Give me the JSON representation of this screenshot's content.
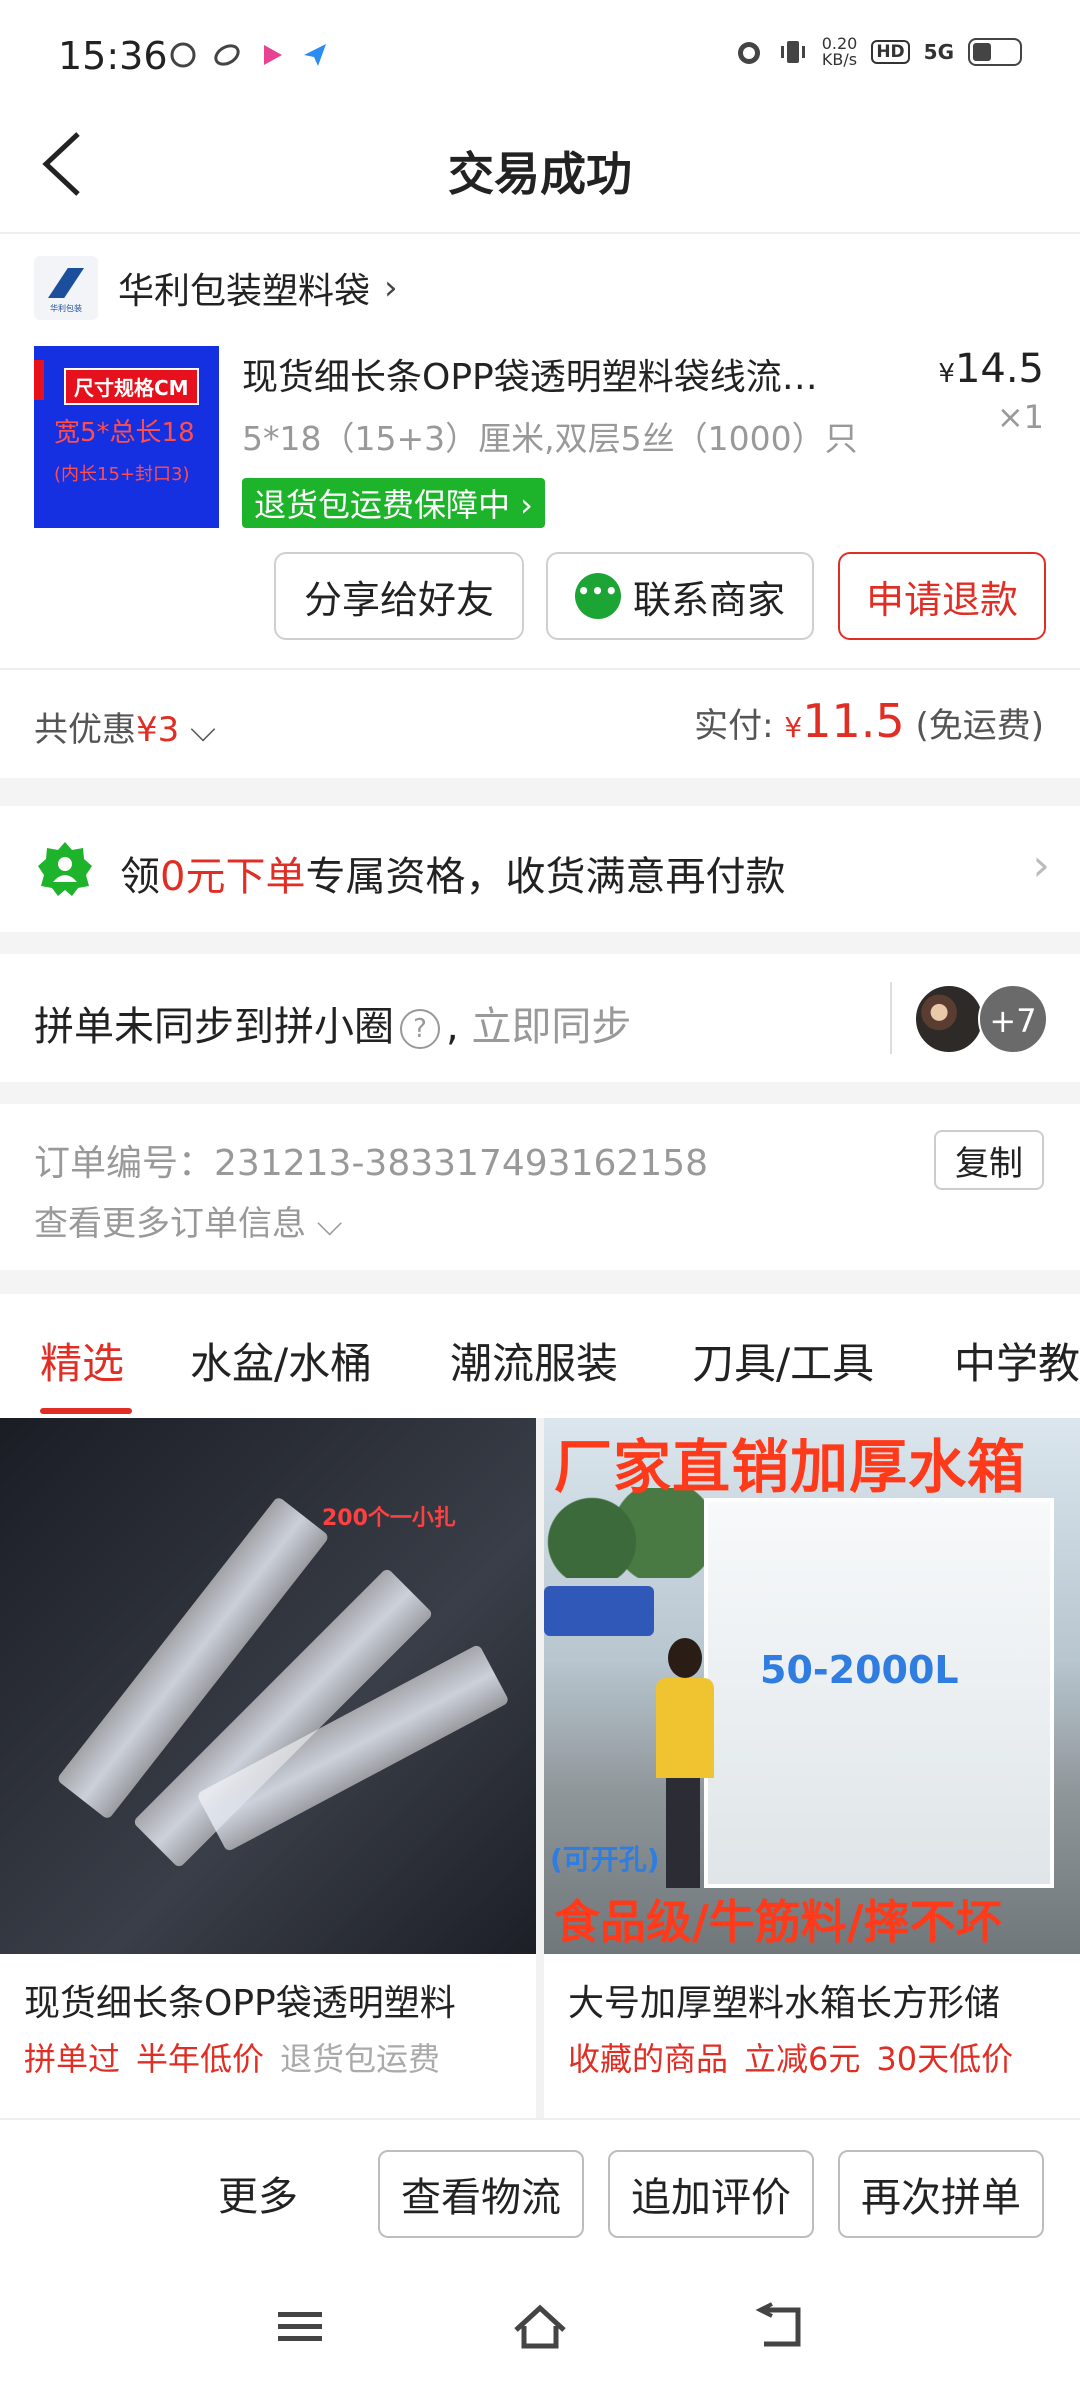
{
  "status_bar": {
    "time": "15:36",
    "net_speed_top": "0.20",
    "net_speed_bottom": "KB/s",
    "hd": "HD",
    "signal": "5G"
  },
  "nav": {
    "title": "交易成功"
  },
  "store": {
    "name": "华利包装塑料袋",
    "logo_text": "华利包装"
  },
  "product": {
    "image_tag": "尺寸规格CM",
    "image_line1": "宽5*总长18",
    "image_line2": "(内长15+封口3)",
    "title": "现货细长条OPP袋透明塑料袋线流…",
    "spec": "5*18（15+3）厘米,双层5丝（1000）只",
    "price_symbol": "¥",
    "price": "14.5",
    "qty": "×1",
    "guarantee": "退货包运费保障中 ›"
  },
  "actions": {
    "share": "分享给好友",
    "contact": "联系商家",
    "refund": "申请退款"
  },
  "summary": {
    "discount_prefix": "共优惠",
    "discount_amount": "¥3",
    "paid_label": "实付:",
    "paid_symbol": "¥",
    "paid_amount": "11.5",
    "shipping": "(免运费)"
  },
  "promo": {
    "pre": "领",
    "red": "0元下单",
    "post": "专属资格，收货满意再付款"
  },
  "sync": {
    "text": "拼单未同步到拼小圈",
    "action": "立即同步",
    "plus": "+7"
  },
  "order": {
    "number_label": "订单编号：",
    "number": "231213-383317493162158",
    "more": "查看更多订单信息",
    "copy": "复制"
  },
  "tabs": [
    "精选",
    "水盆/水桶",
    "潮流服装",
    "刀具/工具",
    "中学教"
  ],
  "products": [
    {
      "img_label": "200个一小扎",
      "title": "现货细长条OPP袋透明塑料",
      "tags_red": [
        "拼单过",
        "半年低价"
      ],
      "tag_grey": "退货包运费"
    },
    {
      "img_head": "厂家直销加厚水箱",
      "img_volume": "50-2000L",
      "img_hole": "(可开孔)",
      "img_foot": "食品级/牛筋料/摔不坏",
      "title": "大号加厚塑料水箱长方形储",
      "tags_red": [
        "收藏的商品",
        "立减6元",
        "30天低价"
      ],
      "tag_grey": ""
    }
  ],
  "bottom_bar": {
    "more": "更多",
    "logistics": "查看物流",
    "review": "追加评价",
    "reorder": "再次拼单"
  },
  "colors": {
    "accent": "#e02e24",
    "green": "#1db32a"
  }
}
